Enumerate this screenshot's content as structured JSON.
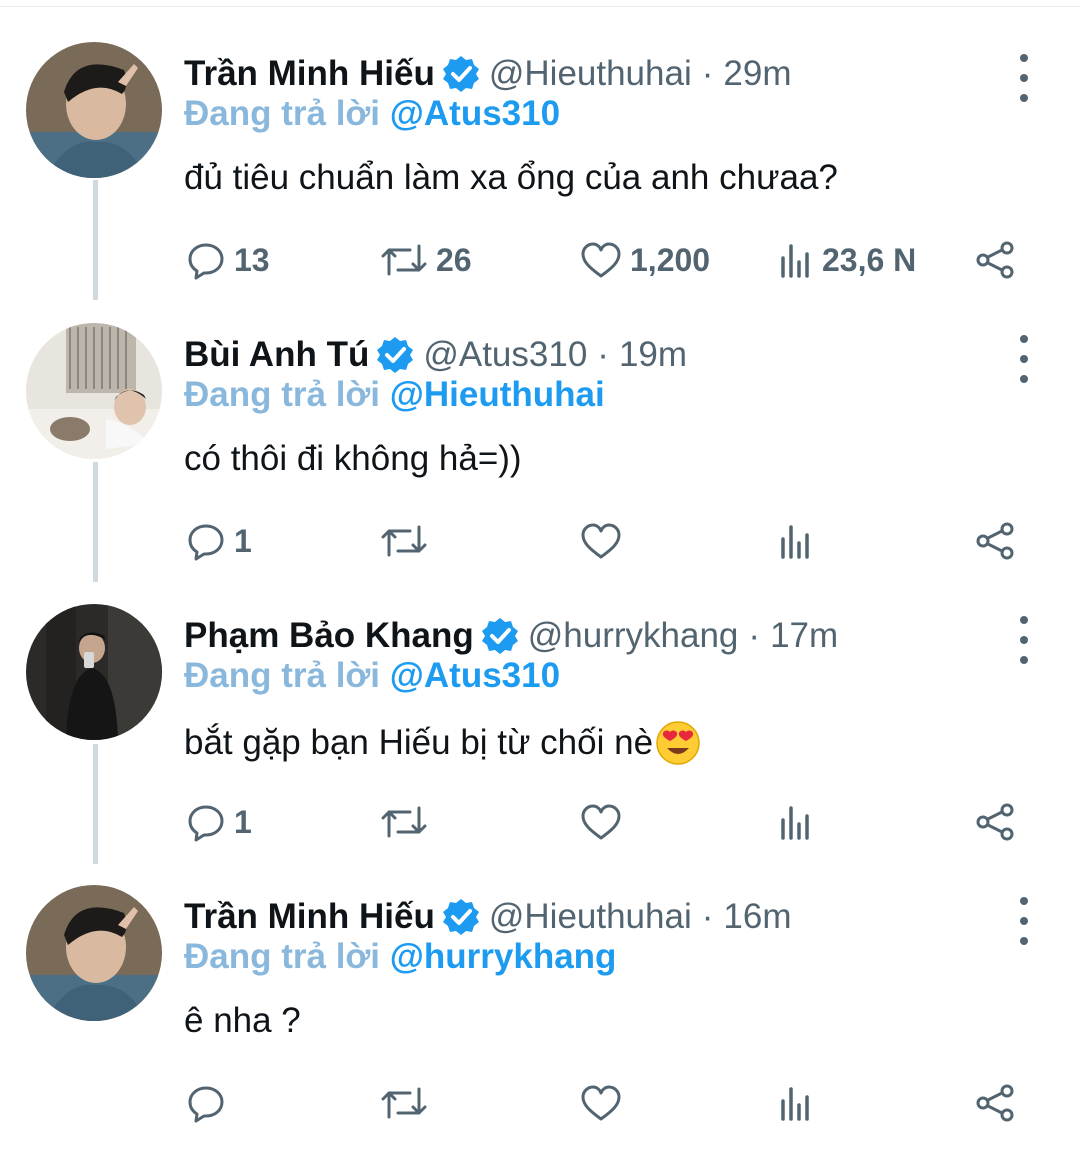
{
  "colors": {
    "accent": "#1d9bf0",
    "reply_prefix": "#8ab8dc",
    "muted": "#536471",
    "thread_line": "#cfd9de"
  },
  "tweets": [
    {
      "name": "Trần Minh Hiếu",
      "handle": "@Hieuthuhai",
      "separator": "·",
      "time": "29m",
      "reply_prefix": "Đang trả lời",
      "reply_to": "@Atus310",
      "text": "đủ tiêu chuẩn làm xa ổng của anh chưaa?",
      "emoji": "",
      "replies": "13",
      "retweets": "26",
      "likes": "1,200",
      "views": "23,6 N"
    },
    {
      "name": "Bùi Anh Tú",
      "handle": "@Atus310",
      "separator": "·",
      "time": "19m",
      "reply_prefix": "Đang trả lời",
      "reply_to": "@Hieuthuhai",
      "text": "có thôi đi không hả=))",
      "emoji": "",
      "replies": "1",
      "retweets": "",
      "likes": "",
      "views": ""
    },
    {
      "name": "Phạm Bảo Khang",
      "handle": "@hurrykhang",
      "separator": "·",
      "time": "17m",
      "reply_prefix": "Đang trả lời",
      "reply_to": "@Atus310",
      "text": "bắt gặp bạn Hiếu bị từ chối nè",
      "emoji": "heart-eyes-emoji",
      "replies": "1",
      "retweets": "",
      "likes": "",
      "views": ""
    },
    {
      "name": "Trần Minh Hiếu",
      "handle": "@Hieuthuhai",
      "separator": "·",
      "time": "16m",
      "reply_prefix": "Đang trả lời",
      "reply_to": "@hurrykhang",
      "text": "ê nha ?",
      "emoji": "",
      "replies": "",
      "retweets": "",
      "likes": "",
      "views": ""
    }
  ],
  "icons": {
    "verified": "verified-badge-icon",
    "more": "more-vertical-icon",
    "reply": "reply-icon",
    "retweet": "retweet-icon",
    "like": "heart-icon",
    "views": "views-icon",
    "share": "share-icon"
  }
}
